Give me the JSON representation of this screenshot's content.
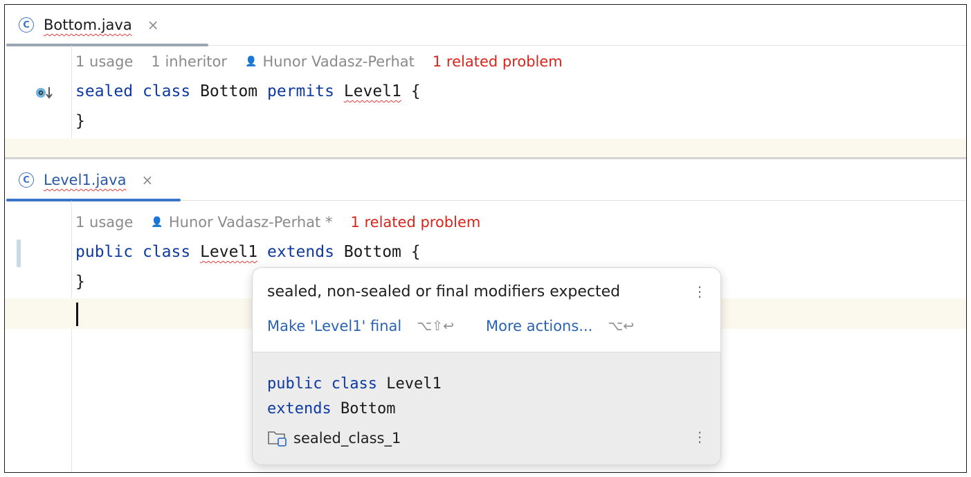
{
  "top_editor": {
    "tab": {
      "file_name": "Bottom.java",
      "class_icon": "C",
      "close_label": "×"
    },
    "inlay": {
      "usages": "1 usage",
      "inheritors": "1 inheritor",
      "author": "Hunor Vadasz-Perhat",
      "problems": "1 related problem"
    },
    "code": {
      "kw1": "sealed",
      "kw2": "class",
      "name": "Bottom",
      "kw3": "permits",
      "ref": "Level1",
      "open_brace": "{",
      "close_brace": "}"
    }
  },
  "bottom_editor": {
    "tab": {
      "file_name": "Level1.java",
      "class_icon": "C",
      "close_label": "×"
    },
    "inlay": {
      "usages": "1 usage",
      "author": "Hunor Vadasz-Perhat *",
      "problems": "1 related problem"
    },
    "code": {
      "kw1": "public",
      "kw2": "class",
      "name": "Level1",
      "kw3": "extends",
      "ref": "Bottom",
      "open_brace": "{",
      "close_brace": "}"
    }
  },
  "popup": {
    "message": "sealed, non-sealed or final modifiers expected",
    "fix_action": "Make 'Level1' final",
    "fix_shortcut": "⌥⇧↩",
    "more_actions": "More actions...",
    "more_shortcut": "⌥↩",
    "menu_icon": "⋮",
    "code_kw1": "public",
    "code_kw2": "class",
    "code_name": "Level1",
    "code_kw3": "extends",
    "code_ref": "Bottom",
    "module": "sealed_class_1"
  }
}
